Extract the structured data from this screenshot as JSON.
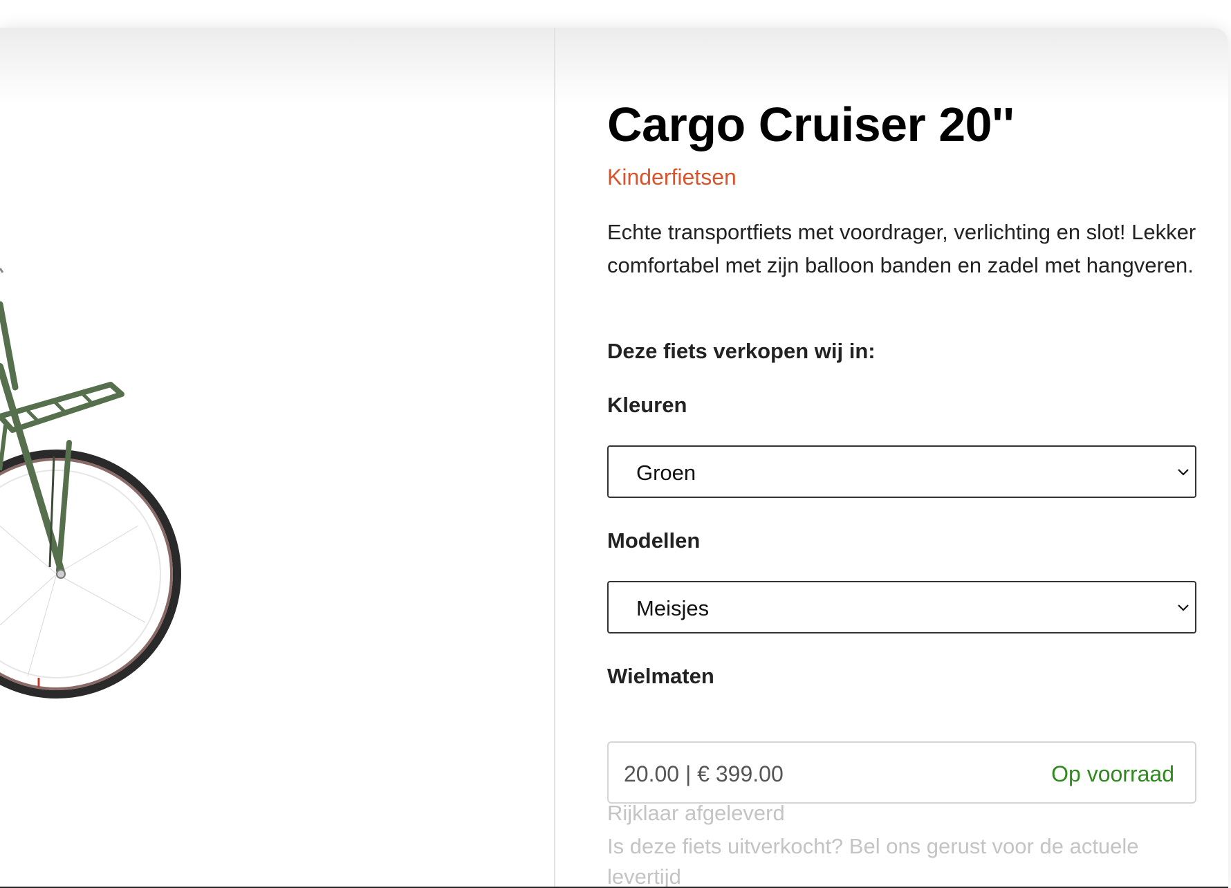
{
  "product": {
    "title": "Cargo Cruiser 20''",
    "category": "Kinderfietsen",
    "description": "Echte transportfiets met voordrager, verlichting en slot! Lekker comfortabel met zijn balloon banden en zadel met hangveren."
  },
  "options": {
    "heading": "Deze fiets verkopen wij in:",
    "colors": {
      "label": "Kleuren",
      "selected": "Groen"
    },
    "models": {
      "label": "Modellen",
      "selected": "Meisjes"
    },
    "wheel_sizes": {
      "label": "Wielmaten",
      "value": "20.00 | € 399.00",
      "status": "Op voorraad"
    }
  },
  "notes": {
    "delivery": "Rijklaar afgeleverd",
    "sold_out_line1": "Is deze fiets uitverkocht? Bel ons gerust voor de actuele",
    "sold_out_line2": "levertijd"
  },
  "colors": {
    "category": "#d9542b",
    "in_stock": "#2f8a1d",
    "muted": "#c4c4c4",
    "bike_frame": "#56704e"
  }
}
